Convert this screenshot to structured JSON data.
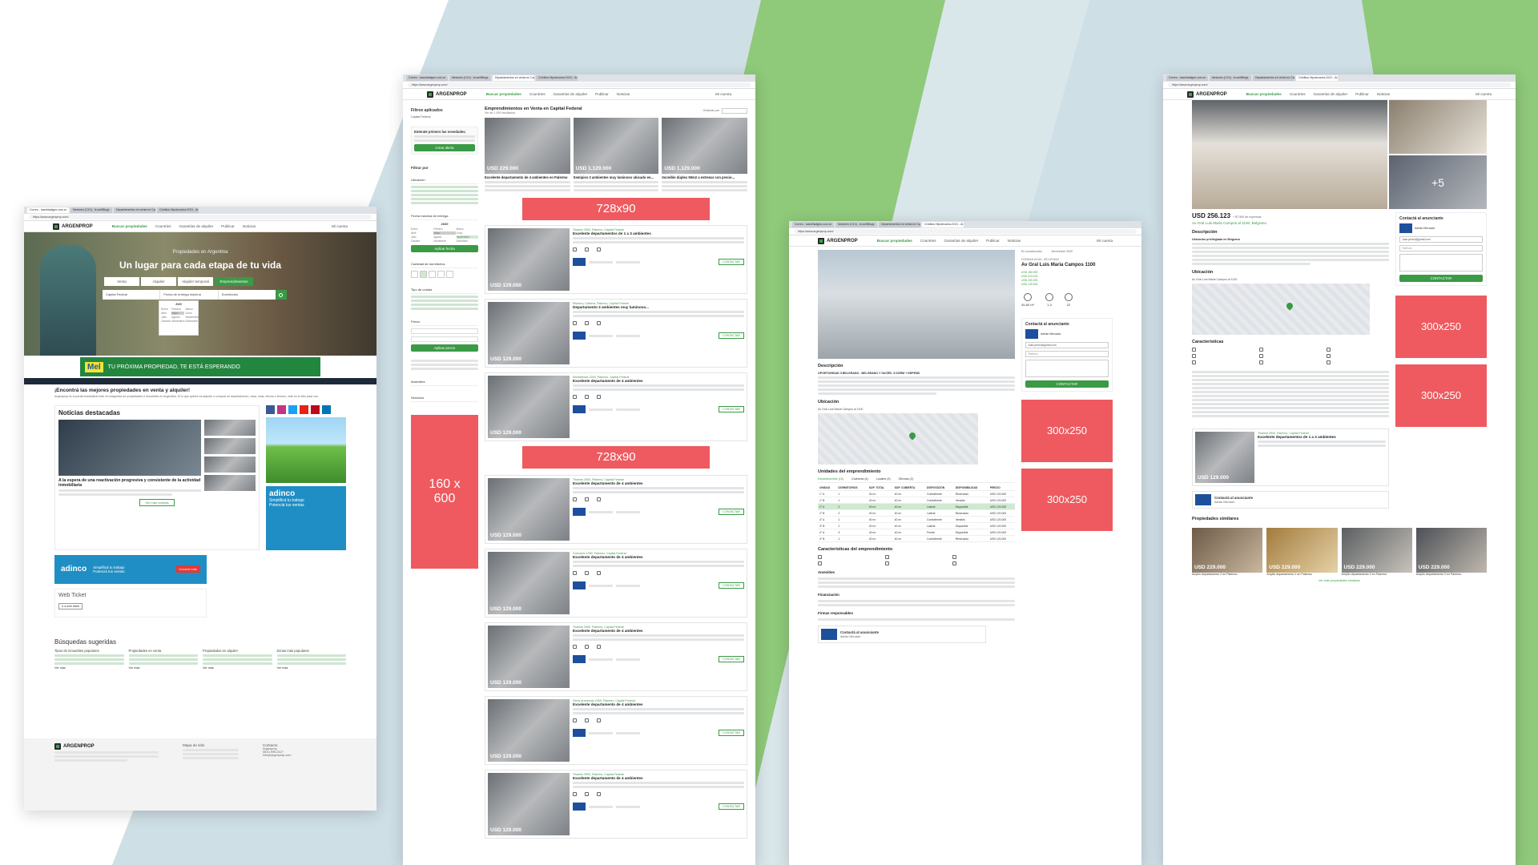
{
  "colors": {
    "accent": "#3a9a45",
    "ad": "#ee5a5f",
    "bg_green": "#8fc97a",
    "bg_blue": "#cfdfe6"
  },
  "browser": {
    "tabs": [
      "Correo - ivanelladigeo.com.ar",
      "Nestores (C10) - Is.wellBlogs",
      "Departamentos en venta en Cap",
      "Créditos Hipotecarios 2021 - Ar"
    ],
    "url": "https://www.argenprop.com/"
  },
  "site": {
    "logo": "ARGENPROP",
    "nav": [
      "Buscar propiedades",
      "Countries",
      "Garantías de alquiler",
      "Publicar",
      "Noticias"
    ],
    "user": "Mi cuenta"
  },
  "home": {
    "hero_title": "Un lugar para cada etapa de tu vida",
    "hero_sub": "Propiedades en Argentina",
    "tabs": [
      "Venta",
      "Alquiler",
      "Alquiler temporal",
      "Emprendimientos"
    ],
    "location": "Capital Federal",
    "date_label": "Fecha de entrega máxima",
    "type_label": "Dormitorios",
    "year": "2020",
    "months": [
      "Enero",
      "Febrero",
      "Marzo",
      "Abril",
      "Mayo",
      "Junio",
      "Julio",
      "Agosto",
      "Septiembre",
      "Octubre",
      "Noviembre",
      "Diciembre"
    ],
    "banner_brand": "Mel",
    "banner_text": "TU PRÓXIMA PROPIEDAD, TE ESTÁ ESPERANDO",
    "intro_title": "¡Encontrá las mejores propiedades en venta y alquiler!",
    "intro_text": "Argenprop es el portal inmobiliario líder en búsqueda de propiedades e inmuebles en Argentina. Si lo que querés es alquilar o comprar un departamento, casa, local, oficina o terreno, este es el sitio para vos.",
    "news_title": "Noticias destacadas",
    "news_headline": "A la espera de una reactivación progresiva y consistente de la actividad inmobiliaria",
    "news_more": "Ver más noticias",
    "adinco_brand": "adinco",
    "adinco_lines": [
      "Simplificá tu trabajo",
      "Potenciá tus ventas"
    ],
    "adinco_cta": "Conocé más",
    "webticket": "Web Ticket",
    "webticket_btn": "Ir a web ticket",
    "suggest_title": "Búsquedas sugeridas",
    "suggest_cols": [
      "Tipos de inmuebles populares",
      "Propiedades en venta",
      "Propiedades en alquiler",
      "Zonas más populares"
    ],
    "see_more": "Ver más",
    "footer_cols": [
      "Mapa de sitio",
      "Contacto"
    ],
    "footer_contact": [
      "Argenprop",
      "0810-999-2427",
      "info@argenprop.com"
    ]
  },
  "listing": {
    "title": "Emprendimientos en Venta en Capital Federal",
    "count": "Ver de 1-500 resultados",
    "order_label": "Ordenar por",
    "filters_title": "Filtros aplicados",
    "filter_chip": "Capital Federal",
    "alert_title": "Enterate primero las novedades.",
    "alert_btn": "Crear alerta",
    "filter_by": "Filtrar por",
    "filter_sections": [
      "Ubicación",
      "Fecha máxima de entrega",
      "Cantidad de dormitorios",
      "Tipo de unidad",
      "Precio",
      "Amenities",
      "Servicios"
    ],
    "apply_date": "Aplicar fecha",
    "apply_price": "Aplicar precio",
    "top_cards": [
      {
        "price": "USD 229.000",
        "title": "Excelente departamento de 4 ambientes en Palermo"
      },
      {
        "price": "USD 1.129.000",
        "title": "Semipiso 3 ambientes muy luminoso ubicado en..."
      },
      {
        "price": "USD 1.129.000",
        "title": "Increíble dúplex 90m2 a estrenar con precio..."
      }
    ],
    "ad_leader": "728x90",
    "ad_sky": "160 x 600",
    "row_price": "USD 129.000",
    "rows": [
      {
        "addr": "Thames 2900, Palermo, Capital Federal",
        "title": "Excelente departamentos de 1 a 3 ambientes"
      },
      {
        "addr": "Riviera y Cabrera, Palermo, Capital Federal",
        "title": "Departamento 3 ambientes muy luminoso..."
      },
      {
        "addr": "Montañeses 2200, Palermo, Capital Federal",
        "title": "Excelente departamento de 4 ambientes"
      },
      {
        "addr": "Thames 2900, Palermo, Capital Federal",
        "title": "Excelente departamento de 4 ambientes"
      },
      {
        "addr": "Guevarrio 1050, Palermo, Capital Federal",
        "title": "Excelente departamento de 4 ambientes"
      },
      {
        "addr": "Thames 2900, Palermo, Capital Federal",
        "title": "Excelente departamento de 4 ambientes"
      },
      {
        "addr": "Virrey Arredondo 2400, Palermo, Capital Federal",
        "title": "Excelente departamento de 4 ambientes"
      },
      {
        "addr": "Thames 2900, Palermo, Capital Federal",
        "title": "Excelente departamento de 4 ambientes"
      }
    ],
    "contact_btn": "CONTACTAR"
  },
  "project": {
    "status": "En construcción",
    "delivery": "Noviembre 2020",
    "location": "DORMAN AGUA - BELGRANO",
    "title": "Av Gral Luis Maria Campos 1100",
    "prices": [
      "USD 160.000",
      "USD 213.100",
      "USD 230.000",
      "USD 129.000"
    ],
    "stats": [
      "45-60 m²",
      "1-3",
      "22"
    ],
    "desc_title": "Descripción",
    "desc_lead": "OPORTUNIDAD II BELGRANO - BELGRANO Y SUCRE- 3 DORM + DEPEND",
    "location_title": "Ubicación",
    "addr": "Av Gral Luis Maria Campos al 1100",
    "units_title": "Unidades del emprendimiento",
    "unit_tabs": [
      "Departamentos (18)",
      "Cocheras (4)",
      "Locales (3)",
      "Oficinas (2)"
    ],
    "unit_cols": [
      "UNIDAD",
      "DORMITORIOS",
      "SUP. TOTAL",
      "SUP. CUBIERTA",
      "DISPOSICIÓN",
      "DISPONIBILIDAD",
      "PRECIO"
    ],
    "unit_rows": [
      [
        "1° A",
        "1",
        "40 m²",
        "40 m²",
        "Contrafrente",
        "Reservado",
        "USD 120.000"
      ],
      [
        "1° B",
        "1",
        "40 m²",
        "40 m²",
        "Contrafrente",
        "Vendido",
        "USD 120.000"
      ],
      [
        "2° A",
        "2",
        "40 m²",
        "40 m²",
        "Lateral",
        "Disponible",
        "USD 120.000"
      ],
      [
        "2° B",
        "2",
        "40 m²",
        "40 m²",
        "Lateral",
        "Reservado",
        "USD 120.000"
      ],
      [
        "3° A",
        "1",
        "40 m²",
        "40 m²",
        "Contrafrente",
        "Vendido",
        "USD 120.000"
      ],
      [
        "3° B",
        "2",
        "40 m²",
        "40 m²",
        "Lateral",
        "Disponible",
        "USD 120.000"
      ],
      [
        "4° A",
        "3",
        "40 m²",
        "40 m²",
        "Frente",
        "Disponible",
        "USD 120.000"
      ],
      [
        "4° B",
        "1",
        "40 m²",
        "40 m²",
        "Contrafrente",
        "Reservado",
        "USD 120.000"
      ]
    ],
    "features_title": "Características del emprendimiento",
    "amen_title": "Amenities",
    "finance_title": "Financiación",
    "firms_title": "Firmas responsables",
    "contact_title": "Contactá al anunciante",
    "advertiser": "Adrian Mercado",
    "contact_btn": "CONTACTAR",
    "email_ph": "Juan.perez@gmail.com",
    "phone_ph": "Teléfono",
    "ad_box": "300x250"
  },
  "detail": {
    "price": "USD 256.123",
    "expenses": "+ $7.500 de expensas",
    "addr": "Av Gral Luis Maria Campos al 1100, Belgrano",
    "photos_more": "+5",
    "desc_title": "Descripción",
    "desc_lead": "Ubicación privilegiada en Belgrano",
    "loc_title": "Ubicación",
    "char_title": "Características",
    "contact_title": "Contactá al anunciante",
    "advertiser": "Adrian Mercado",
    "contact_btn": "CONTACTAR",
    "ad_box": "300x250",
    "related_price": "USD 129.000",
    "related_addr": "Thames 2900, Palermo, Capital Federal",
    "related_title": "Excelente departamentos de 1 a 3 ambientes",
    "similar_title": "Propiedades similares",
    "similar": [
      {
        "price": "USD 229.000",
        "title": "Amplio departamento 2 en Palermo"
      },
      {
        "price": "USD 229.000",
        "title": "Amplio departamento 2 en Palermo"
      },
      {
        "price": "USD 229.000",
        "title": "Amplio departamento 2 en Palermo"
      },
      {
        "price": "USD 229.000",
        "title": "Amplio departamento 2 en Palermo"
      }
    ],
    "similar_more": "Ver más propiedades similares"
  }
}
